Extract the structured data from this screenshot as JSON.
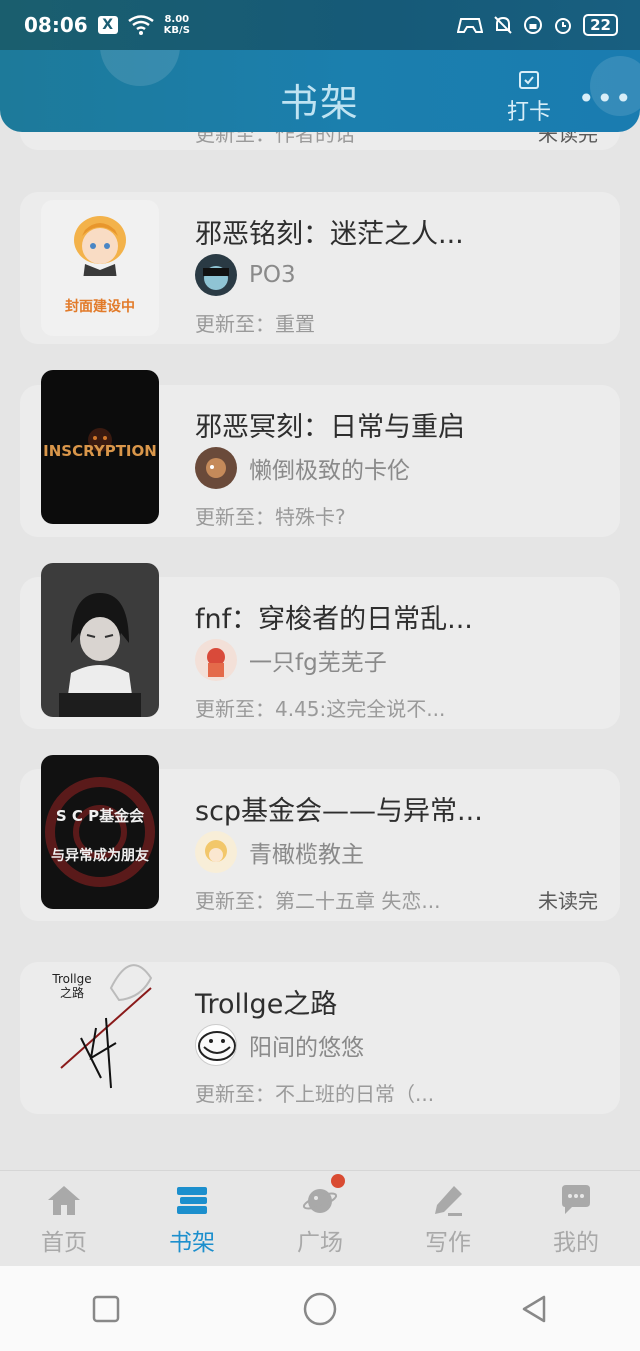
{
  "status_bar": {
    "time": "08:06",
    "x_icon": "X",
    "net_speed": "8.00",
    "net_unit": "KB/S",
    "battery": "22"
  },
  "header": {
    "title": "书架",
    "checkin_label": "打卡",
    "more": "•••"
  },
  "partial_card": {
    "update": "更新至：作者的话",
    "status": "未读完"
  },
  "books": [
    {
      "title": "邪恶铭刻：迷茫之人...",
      "author": "PO3",
      "update": "更新至：重置",
      "status": "",
      "cover_text": "封面建设中"
    },
    {
      "title": "邪恶冥刻：日常与重启",
      "author": "懒倒极致的卡伦",
      "update": "更新至：特殊卡?",
      "status": "",
      "cover_text": "INSCRYPTION"
    },
    {
      "title": "fnf：穿梭者的日常乱...",
      "author": "一只fg芜芜子",
      "update": "更新至：4.45:这完全说不...",
      "status": "",
      "cover_text": ""
    },
    {
      "title": "scp基金会——与异常...",
      "author": "青橄榄教主",
      "update": "更新至：第二十五章 失恋...",
      "status": "未读完",
      "cover_text": "S C P基金会",
      "cover_text2": "与异常成为朋友"
    },
    {
      "title": "Trollge之路",
      "author": "阳间的悠悠",
      "update": "更新至：不上班的日常（...",
      "status": "",
      "cover_text": "Trollge",
      "cover_text2": "之路"
    }
  ],
  "nav": {
    "items": [
      {
        "label": "首页",
        "icon": "home-icon"
      },
      {
        "label": "书架",
        "icon": "bookshelf-icon"
      },
      {
        "label": "广场",
        "icon": "planet-icon"
      },
      {
        "label": "写作",
        "icon": "pen-icon"
      },
      {
        "label": "我的",
        "icon": "chat-bubble-icon"
      }
    ],
    "active_index": 1
  },
  "colors": {
    "accent": "#1c8fcd",
    "header": "#1b7fae",
    "badge": "#d94b32"
  }
}
